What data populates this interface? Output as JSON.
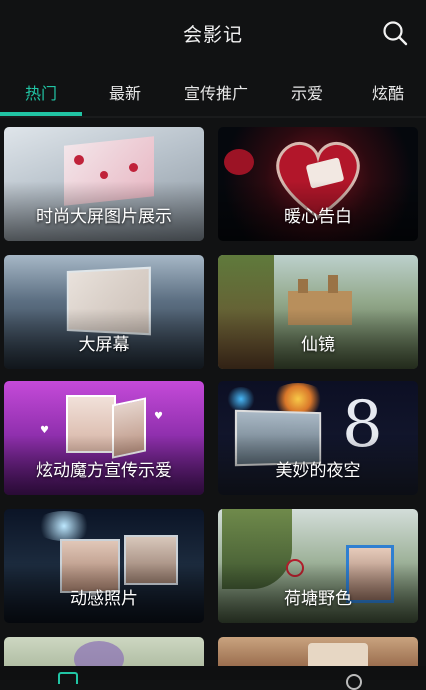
{
  "app": {
    "title": "会影记"
  },
  "tabs": [
    {
      "label": "热门",
      "active": true
    },
    {
      "label": "最新",
      "active": false
    },
    {
      "label": "宣传推广",
      "active": false
    },
    {
      "label": "示爱",
      "active": false
    },
    {
      "label": "炫酷",
      "active": false
    }
  ],
  "cards": [
    {
      "label": "时尚大屏图片展示"
    },
    {
      "label": "暖心告白"
    },
    {
      "label": "大屏幕"
    },
    {
      "label": "仙镜"
    },
    {
      "label": "炫动魔方宣传示爱"
    },
    {
      "label": "美妙的夜空"
    },
    {
      "label": "动感照片"
    },
    {
      "label": "荷塘野色"
    }
  ],
  "colors": {
    "accent": "#21c4a4",
    "background": "#111213"
  },
  "icons": {
    "search": "search-icon",
    "bottom_left": "home-icon",
    "bottom_right": "profile-icon"
  }
}
